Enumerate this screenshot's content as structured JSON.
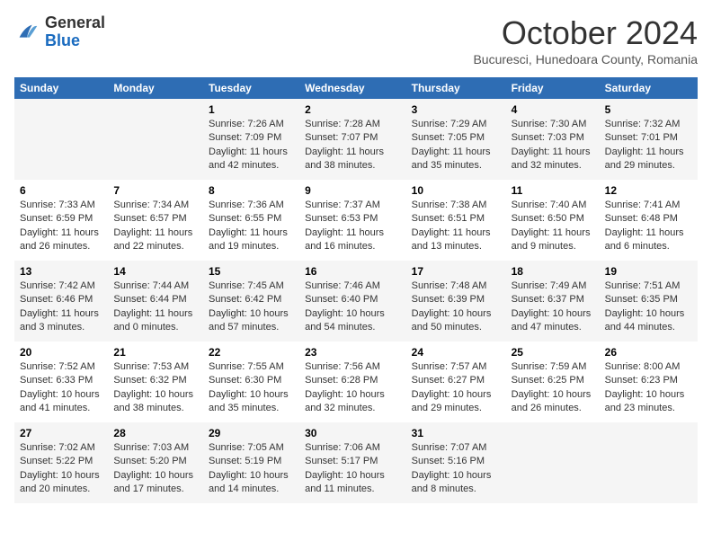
{
  "logo": {
    "general": "General",
    "blue": "Blue"
  },
  "title": "October 2024",
  "subtitle": "Bucuresci, Hunedoara County, Romania",
  "days_of_week": [
    "Sunday",
    "Monday",
    "Tuesday",
    "Wednesday",
    "Thursday",
    "Friday",
    "Saturday"
  ],
  "weeks": [
    [
      {
        "day": "",
        "info": ""
      },
      {
        "day": "",
        "info": ""
      },
      {
        "day": "1",
        "info": "Sunrise: 7:26 AM\nSunset: 7:09 PM\nDaylight: 11 hours and 42 minutes."
      },
      {
        "day": "2",
        "info": "Sunrise: 7:28 AM\nSunset: 7:07 PM\nDaylight: 11 hours and 38 minutes."
      },
      {
        "day": "3",
        "info": "Sunrise: 7:29 AM\nSunset: 7:05 PM\nDaylight: 11 hours and 35 minutes."
      },
      {
        "day": "4",
        "info": "Sunrise: 7:30 AM\nSunset: 7:03 PM\nDaylight: 11 hours and 32 minutes."
      },
      {
        "day": "5",
        "info": "Sunrise: 7:32 AM\nSunset: 7:01 PM\nDaylight: 11 hours and 29 minutes."
      }
    ],
    [
      {
        "day": "6",
        "info": "Sunrise: 7:33 AM\nSunset: 6:59 PM\nDaylight: 11 hours and 26 minutes."
      },
      {
        "day": "7",
        "info": "Sunrise: 7:34 AM\nSunset: 6:57 PM\nDaylight: 11 hours and 22 minutes."
      },
      {
        "day": "8",
        "info": "Sunrise: 7:36 AM\nSunset: 6:55 PM\nDaylight: 11 hours and 19 minutes."
      },
      {
        "day": "9",
        "info": "Sunrise: 7:37 AM\nSunset: 6:53 PM\nDaylight: 11 hours and 16 minutes."
      },
      {
        "day": "10",
        "info": "Sunrise: 7:38 AM\nSunset: 6:51 PM\nDaylight: 11 hours and 13 minutes."
      },
      {
        "day": "11",
        "info": "Sunrise: 7:40 AM\nSunset: 6:50 PM\nDaylight: 11 hours and 9 minutes."
      },
      {
        "day": "12",
        "info": "Sunrise: 7:41 AM\nSunset: 6:48 PM\nDaylight: 11 hours and 6 minutes."
      }
    ],
    [
      {
        "day": "13",
        "info": "Sunrise: 7:42 AM\nSunset: 6:46 PM\nDaylight: 11 hours and 3 minutes."
      },
      {
        "day": "14",
        "info": "Sunrise: 7:44 AM\nSunset: 6:44 PM\nDaylight: 11 hours and 0 minutes."
      },
      {
        "day": "15",
        "info": "Sunrise: 7:45 AM\nSunset: 6:42 PM\nDaylight: 10 hours and 57 minutes."
      },
      {
        "day": "16",
        "info": "Sunrise: 7:46 AM\nSunset: 6:40 PM\nDaylight: 10 hours and 54 minutes."
      },
      {
        "day": "17",
        "info": "Sunrise: 7:48 AM\nSunset: 6:39 PM\nDaylight: 10 hours and 50 minutes."
      },
      {
        "day": "18",
        "info": "Sunrise: 7:49 AM\nSunset: 6:37 PM\nDaylight: 10 hours and 47 minutes."
      },
      {
        "day": "19",
        "info": "Sunrise: 7:51 AM\nSunset: 6:35 PM\nDaylight: 10 hours and 44 minutes."
      }
    ],
    [
      {
        "day": "20",
        "info": "Sunrise: 7:52 AM\nSunset: 6:33 PM\nDaylight: 10 hours and 41 minutes."
      },
      {
        "day": "21",
        "info": "Sunrise: 7:53 AM\nSunset: 6:32 PM\nDaylight: 10 hours and 38 minutes."
      },
      {
        "day": "22",
        "info": "Sunrise: 7:55 AM\nSunset: 6:30 PM\nDaylight: 10 hours and 35 minutes."
      },
      {
        "day": "23",
        "info": "Sunrise: 7:56 AM\nSunset: 6:28 PM\nDaylight: 10 hours and 32 minutes."
      },
      {
        "day": "24",
        "info": "Sunrise: 7:57 AM\nSunset: 6:27 PM\nDaylight: 10 hours and 29 minutes."
      },
      {
        "day": "25",
        "info": "Sunrise: 7:59 AM\nSunset: 6:25 PM\nDaylight: 10 hours and 26 minutes."
      },
      {
        "day": "26",
        "info": "Sunrise: 8:00 AM\nSunset: 6:23 PM\nDaylight: 10 hours and 23 minutes."
      }
    ],
    [
      {
        "day": "27",
        "info": "Sunrise: 7:02 AM\nSunset: 5:22 PM\nDaylight: 10 hours and 20 minutes."
      },
      {
        "day": "28",
        "info": "Sunrise: 7:03 AM\nSunset: 5:20 PM\nDaylight: 10 hours and 17 minutes."
      },
      {
        "day": "29",
        "info": "Sunrise: 7:05 AM\nSunset: 5:19 PM\nDaylight: 10 hours and 14 minutes."
      },
      {
        "day": "30",
        "info": "Sunrise: 7:06 AM\nSunset: 5:17 PM\nDaylight: 10 hours and 11 minutes."
      },
      {
        "day": "31",
        "info": "Sunrise: 7:07 AM\nSunset: 5:16 PM\nDaylight: 10 hours and 8 minutes."
      },
      {
        "day": "",
        "info": ""
      },
      {
        "day": "",
        "info": ""
      }
    ]
  ]
}
